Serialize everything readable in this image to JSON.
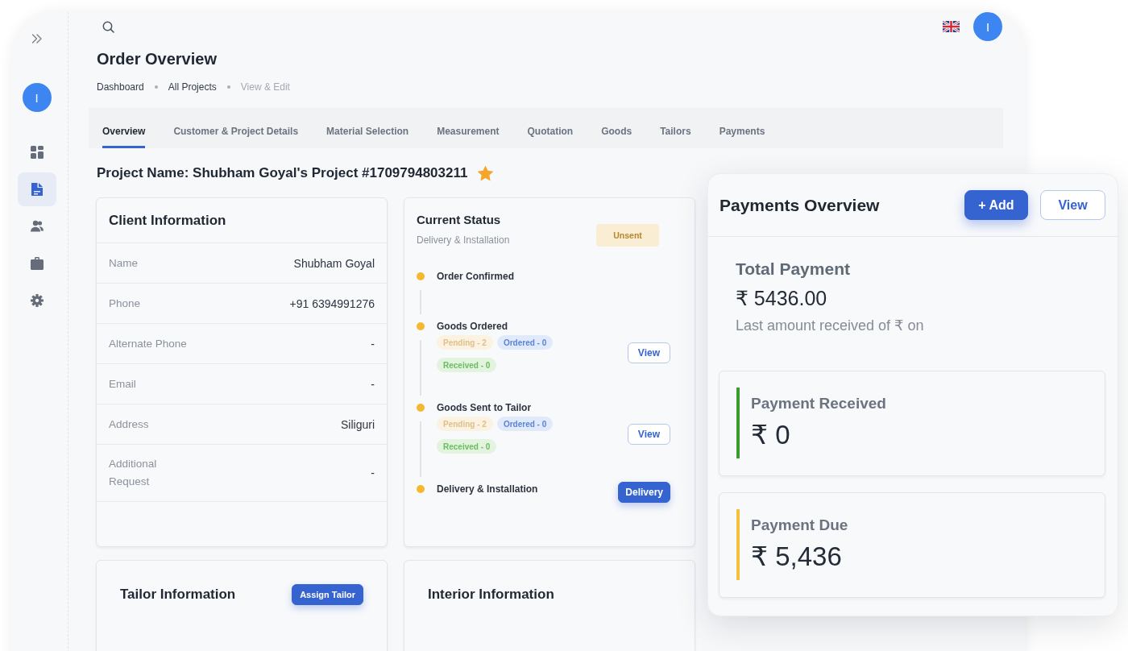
{
  "sidebar": {
    "avatar_initial": "I",
    "items": [
      {
        "kind": "grid",
        "selected": false
      },
      {
        "kind": "document",
        "selected": true
      },
      {
        "kind": "people",
        "selected": false
      },
      {
        "kind": "briefcase",
        "selected": false
      },
      {
        "kind": "gear",
        "selected": false
      }
    ]
  },
  "topbar": {
    "avatar_initial": "I"
  },
  "page": {
    "title": "Order Overview",
    "breadcrumbs": [
      {
        "label": "Dashboard",
        "current": false
      },
      {
        "label": "All Projects",
        "current": false
      },
      {
        "label": "View & Edit",
        "current": true
      }
    ]
  },
  "tabs": [
    {
      "label": "Overview",
      "selected": true
    },
    {
      "label": "Customer & Project Details",
      "selected": false
    },
    {
      "label": "Material Selection",
      "selected": false
    },
    {
      "label": "Measurement",
      "selected": false
    },
    {
      "label": "Quotation",
      "selected": false
    },
    {
      "label": "Goods",
      "selected": false
    },
    {
      "label": "Tailors",
      "selected": false
    },
    {
      "label": "Payments",
      "selected": false
    }
  ],
  "project": {
    "title": "Project Name: Shubham Goyal's Project #1709794803211",
    "starred": true
  },
  "client_information": {
    "title": "Client Information",
    "rows": [
      {
        "label": "Name",
        "value": "Shubham Goyal"
      },
      {
        "label": "Phone",
        "value": "+91 6394991276"
      },
      {
        "label": "Alternate Phone",
        "value": "-"
      },
      {
        "label": "Email",
        "value": "-"
      },
      {
        "label": "Address",
        "value": "Siliguri"
      },
      {
        "label": "Additional Request",
        "value": "-"
      }
    ]
  },
  "current_status": {
    "title": "Current Status",
    "subtitle": "Delivery & Installation",
    "badge": "Unsent",
    "steps": [
      {
        "label": "Order Confirmed"
      },
      {
        "label": "Goods Ordered",
        "tags": [
          {
            "label": "Pending - 2",
            "kind": "pending"
          },
          {
            "label": "Ordered - 0",
            "kind": "ordered"
          },
          {
            "label": "Received - 0",
            "kind": "received"
          }
        ],
        "button": {
          "label": "View",
          "kind": "outline"
        }
      },
      {
        "label": "Goods Sent to Tailor",
        "tags": [
          {
            "label": "Pending - 2",
            "kind": "pending"
          },
          {
            "label": "Ordered - 0",
            "kind": "ordered"
          },
          {
            "label": "Received - 0",
            "kind": "received"
          }
        ],
        "button": {
          "label": "View",
          "kind": "outline"
        }
      },
      {
        "label": "Delivery & Installation",
        "button": {
          "label": "Delivery",
          "kind": "primary"
        }
      }
    ]
  },
  "tailor_information": {
    "title": "Tailor Information",
    "button": "Assign Tailor"
  },
  "interior_information": {
    "title": "Interior Information"
  },
  "payments_overview": {
    "title": "Payments Overview",
    "buttons": [
      {
        "label": "+ Add",
        "kind": "primary"
      },
      {
        "label": "View",
        "kind": "outline"
      }
    ],
    "total": {
      "label": "Total Payment",
      "amount": "₹ 5436.00",
      "note": "Last amount received of ₹ on"
    },
    "cards": [
      {
        "label": "Payment Received",
        "amount": "₹ 0",
        "color": "#3d9a2f"
      },
      {
        "label": "Payment Due",
        "amount": "₹ 5,436",
        "color": "#f3bf3c"
      }
    ]
  }
}
